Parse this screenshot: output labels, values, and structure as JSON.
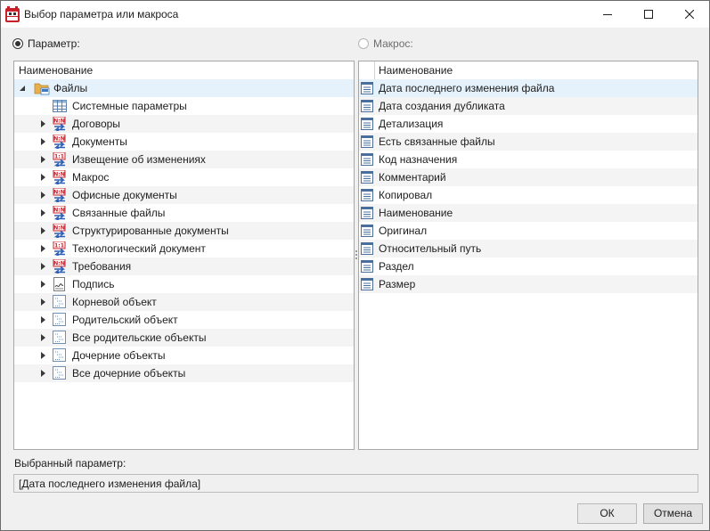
{
  "window": {
    "title": "Выбор параметра или макроса",
    "app_icon": "tflex-app-icon",
    "controls": [
      "minimize-icon",
      "maximize-icon",
      "close-icon"
    ]
  },
  "mode": {
    "parameter_label": "Параметр:",
    "parameter_selected": true,
    "macro_label": "Макрос:",
    "macro_selected": false
  },
  "tree": {
    "header": "Наименование",
    "root": {
      "label": "Файлы",
      "icon": "folder-icon",
      "expanded": true
    },
    "children": [
      {
        "label": "Системные параметры",
        "icon": "table-icon",
        "expandable": false
      },
      {
        "label": "Договоры",
        "icon": "many-to-many-link-icon",
        "expandable": true
      },
      {
        "label": "Документы",
        "icon": "many-to-many-link-icon",
        "expandable": true
      },
      {
        "label": "Извещение об изменениях",
        "icon": "one-to-one-link-icon",
        "expandable": true
      },
      {
        "label": "Макрос",
        "icon": "many-to-many-link-icon",
        "expandable": true
      },
      {
        "label": "Офисные документы",
        "icon": "many-to-many-link-icon",
        "expandable": true
      },
      {
        "label": "Связанные файлы",
        "icon": "many-to-many-link-icon",
        "expandable": true
      },
      {
        "label": "Структурированные документы",
        "icon": "many-to-many-link-icon",
        "expandable": true
      },
      {
        "label": "Технологический документ",
        "icon": "one-to-one-link-icon",
        "expandable": true
      },
      {
        "label": "Требования",
        "icon": "many-to-many-link-icon",
        "expandable": true
      },
      {
        "label": "Подпись",
        "icon": "signature-icon",
        "expandable": true
      },
      {
        "label": "Корневой объект",
        "icon": "object-list-icon",
        "expandable": true
      },
      {
        "label": "Родительский объект",
        "icon": "object-list-icon",
        "expandable": true
      },
      {
        "label": "Все родительские объекты",
        "icon": "object-list-icon",
        "expandable": true
      },
      {
        "label": "Дочерние объекты",
        "icon": "object-list-icon",
        "expandable": true
      },
      {
        "label": "Все дочерние объекты",
        "icon": "object-list-icon",
        "expandable": true
      }
    ]
  },
  "params": {
    "header": "Наименование",
    "items": [
      {
        "label": "Дата последнего изменения файла",
        "icon": "parameter-icon",
        "selected": true
      },
      {
        "label": "Дата создания дубликата",
        "icon": "parameter-icon"
      },
      {
        "label": "Детализация",
        "icon": "parameter-icon"
      },
      {
        "label": "Есть связанные файлы",
        "icon": "parameter-icon"
      },
      {
        "label": "Код назначения",
        "icon": "parameter-icon"
      },
      {
        "label": "Комментарий",
        "icon": "parameter-icon"
      },
      {
        "label": "Копировал",
        "icon": "parameter-icon"
      },
      {
        "label": "Наименование",
        "icon": "parameter-icon"
      },
      {
        "label": "Оригинал",
        "icon": "parameter-icon"
      },
      {
        "label": "Относительный путь",
        "icon": "parameter-icon"
      },
      {
        "label": "Раздел",
        "icon": "parameter-icon"
      },
      {
        "label": "Размер",
        "icon": "parameter-icon"
      }
    ]
  },
  "selection": {
    "label": "Выбранный параметр:",
    "value": "[Дата последнего изменения файла]"
  },
  "buttons": {
    "ok": "ОК",
    "cancel": "Отмена"
  },
  "colors": {
    "selection": "#e5f1fb",
    "link_red": "#c8202a",
    "link_blue": "#2b5fb5"
  }
}
